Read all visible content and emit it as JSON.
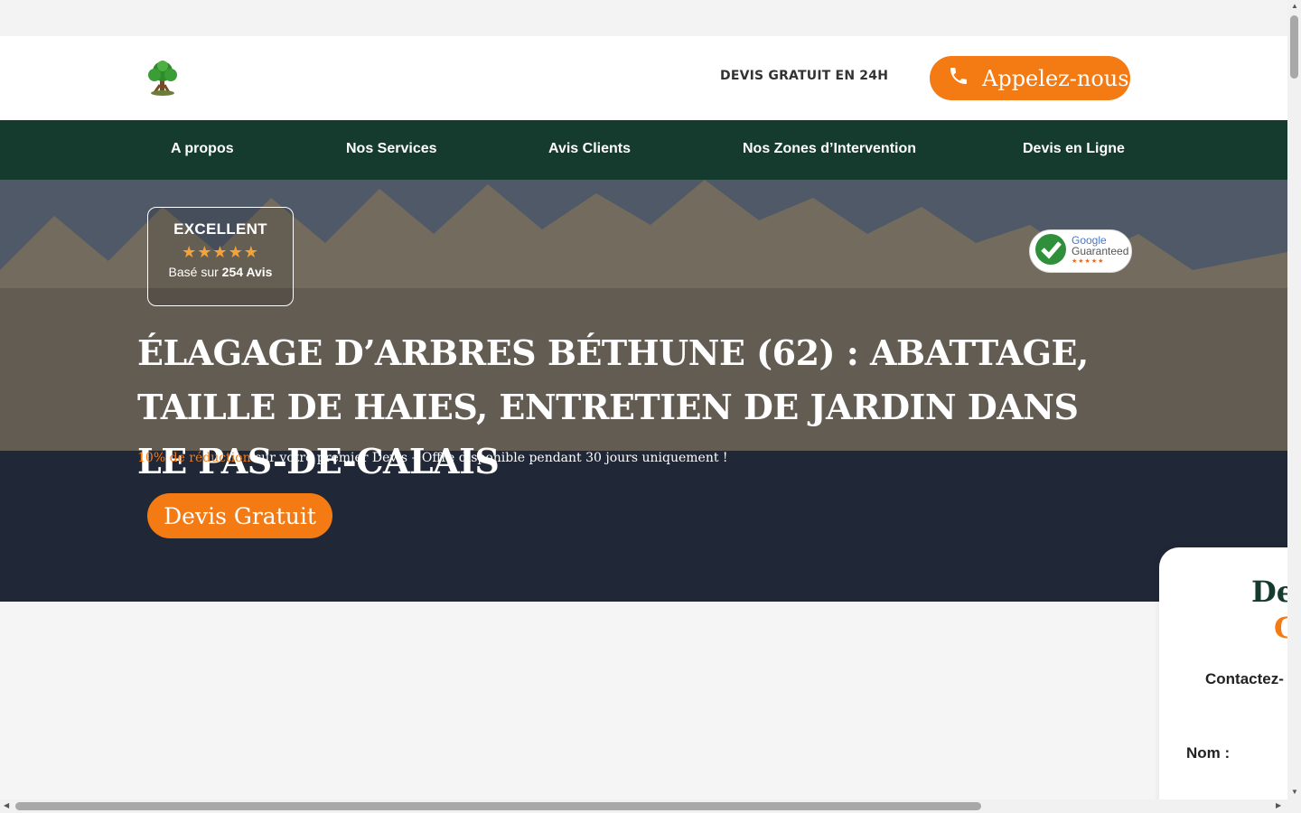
{
  "header": {
    "logo_icon": "tree-logo-icon",
    "devis_text": "DEVIS GRATUIT EN 24H",
    "call_button": {
      "label": "Appelez-nous",
      "icon": "phone-icon"
    },
    "accent_color": "#f47a13"
  },
  "nav": {
    "background": "#153b2e",
    "items": [
      {
        "label": "A propos"
      },
      {
        "label": "Nos Services"
      },
      {
        "label": "Avis Clients"
      },
      {
        "label": "Nos Zones d’Intervention"
      },
      {
        "label": "Devis en Ligne"
      }
    ]
  },
  "hero": {
    "rating": {
      "title": "EXCELLENT",
      "stars": "★★★★★",
      "rating_value": 5,
      "based_prefix": "Basé sur ",
      "based_count": "254 Avis"
    },
    "google_badge": {
      "line1": "Google",
      "line2": "Guaranteed",
      "stars": "★★★★★"
    },
    "headline": "ÉLAGAGE D’ARBRES BÉTHUNE (62) : ABATTAGE, TAILLE DE HAIES, ENTRETIEN DE JARDIN DANS LE PAS-DE-CALAIS",
    "promo_highlight": "10% de réduction",
    "promo_rest": " sur votre premier Devis – Offre disponible pendant 30 jours uniquement !",
    "cta_label": "Devis Gratuit"
  },
  "form": {
    "title_part1": "De",
    "title_part2": "G",
    "contact_text": "Contactez-",
    "name_label": "Nom :"
  }
}
